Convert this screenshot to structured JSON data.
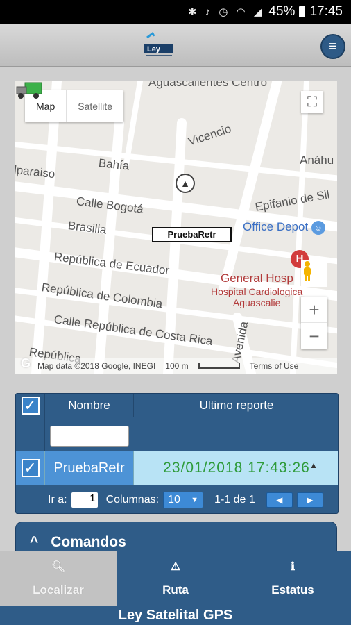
{
  "status_bar": {
    "icons": [
      "bluetooth-icon",
      "mute-icon",
      "alarm-icon",
      "wifi-icon",
      "signal-icon"
    ],
    "battery": "45%",
    "time": "17:45"
  },
  "app_bar": {
    "logo_text": "Ley",
    "menu_icon": "hamburger-icon"
  },
  "map": {
    "type_map_label": "Map",
    "type_satellite_label": "Satellite",
    "fullscreen_icon": "fullscreen-icon",
    "streets": {
      "centro": "Aguascalientes Centro",
      "vicencio": "Vicencio",
      "anahu": "Anáhu",
      "bahia": "Bahía",
      "paraiso": "lparaiso",
      "bogota": "Calle Bogotá",
      "epifanio": "Epifanio de Sil",
      "brasilia": "Brasilia",
      "ecuador": "República de Ecuador",
      "colombia": "República de Colombia",
      "costa_rica": "Calle República de Costa Rica",
      "avenida": "Avenida",
      "republica": "República"
    },
    "pois": {
      "office_depot": "Office Depot",
      "hospital_general": "General Hosp",
      "hospital_cardio_1": "Hospital Cardiologica",
      "hospital_cardio_2": "Aguascalie"
    },
    "hospital_icon_letter": "H",
    "vehicle_label": "PruebaRetr",
    "zoom_in": "+",
    "zoom_out": "−",
    "attribution": "Map data ©2018 Google, INEGI",
    "scale": "100 m",
    "terms": "Terms of Use",
    "google_logo": "G"
  },
  "grid": {
    "headers": {
      "nombre": "Nombre",
      "ultimo_reporte": "Ultimo reporte"
    },
    "filter_value": "",
    "rows": [
      {
        "nombre": "PruebaRetr",
        "ultimo_reporte": "23/01/2018 17:43:26",
        "direction": "▲"
      }
    ],
    "pager": {
      "ir_a_label": "Ir a:",
      "page_value": "1",
      "columnas_label": "Columnas:",
      "columnas_value": "10",
      "range": "1-1 de 1"
    }
  },
  "comandos": {
    "label": "Comandos",
    "chevron": "^"
  },
  "bottom_nav": [
    {
      "label": "Localizar",
      "icon": "search-icon",
      "active": true
    },
    {
      "label": "Ruta",
      "icon": "warning-icon",
      "active": false
    },
    {
      "label": "Estatus",
      "icon": "info-icon",
      "active": false
    }
  ],
  "footer": {
    "text": "Ley Satelital GPS"
  },
  "colors": {
    "primary": "#2f5c88",
    "row_highlight": "#b8e3f5",
    "date_green": "#2e9b3a"
  }
}
